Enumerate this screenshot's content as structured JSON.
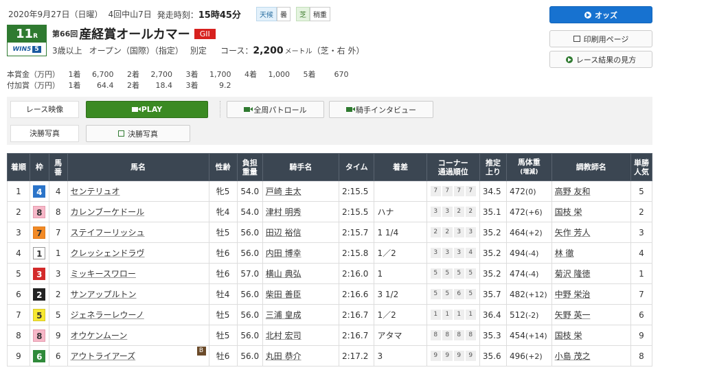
{
  "header": {
    "date": "2020年9月27日（日曜）",
    "meeting": "4回中山7日",
    "post_time_label": "発走時刻：",
    "post_time": "15時45分",
    "weather_label": "天候",
    "weather": "曇",
    "surface_label": "芝",
    "condition": "稍重"
  },
  "race": {
    "number": "11",
    "number_suffix": "R",
    "win5_label": "WIN5",
    "win5_num": "5",
    "edition": "第66回",
    "name": "産経賞オールカマー",
    "grade": "GII",
    "age": "3歳以上",
    "class": "オープン（国際）（指定）",
    "weight_rule": "別定",
    "course_label": "コース：",
    "distance": "2,200",
    "distance_unit": "メートル",
    "course_detail": "（芝・右 外）"
  },
  "prize": {
    "main_label": "本賞金（万円）",
    "main": [
      {
        "place": "1着",
        "amount": "6,700"
      },
      {
        "place": "2着",
        "amount": "2,700"
      },
      {
        "place": "3着",
        "amount": "1,700"
      },
      {
        "place": "4着",
        "amount": "1,000"
      },
      {
        "place": "5着",
        "amount": "670"
      }
    ],
    "extra_label": "付加賞（万円）",
    "extra": [
      {
        "place": "1着",
        "amount": "64.4"
      },
      {
        "place": "2着",
        "amount": "18.4"
      },
      {
        "place": "3着",
        "amount": "9.2"
      }
    ]
  },
  "side_buttons": {
    "odds": "オッズ",
    "print": "印刷用ページ",
    "guide": "レース結果の見方"
  },
  "media": {
    "video_label": "レース映像",
    "play": "PLAY",
    "patrol": "全周パトロール",
    "interview": "騎手インタビュー",
    "photo_label": "決勝写真",
    "photo_btn": "決勝写真"
  },
  "table": {
    "headers": [
      "着順",
      "枠",
      "馬番",
      "馬名",
      "性齢",
      "負担重量",
      "騎手名",
      "タイム",
      "着差",
      "コーナー通過順位",
      "推定上り",
      "馬体重(増減)",
      "調教師名",
      "単勝人気"
    ],
    "rows": [
      {
        "pos": "1",
        "waku": "4",
        "num": "4",
        "horse": "センテリュオ",
        "blinker": "",
        "sex_age": "牝5",
        "weight": "54.0",
        "jockey": "戸崎 圭太",
        "time": "2:15.5",
        "margin": "",
        "corner": [
          "7",
          "7",
          "7",
          "7"
        ],
        "last3f": "34.5",
        "body": "472",
        "diff": "(0)",
        "trainer": "高野 友和",
        "pop": "5"
      },
      {
        "pos": "2",
        "waku": "8",
        "num": "8",
        "horse": "カレンブーケドール",
        "blinker": "",
        "sex_age": "牝4",
        "weight": "54.0",
        "jockey": "津村 明秀",
        "time": "2:15.5",
        "margin": "ハナ",
        "corner": [
          "3",
          "3",
          "2",
          "2"
        ],
        "last3f": "35.1",
        "body": "472",
        "diff": "(+6)",
        "trainer": "国枝 栄",
        "pop": "2"
      },
      {
        "pos": "3",
        "waku": "7",
        "num": "7",
        "horse": "ステイフーリッシュ",
        "blinker": "",
        "sex_age": "牡5",
        "weight": "56.0",
        "jockey": "田辺 裕信",
        "time": "2:15.7",
        "margin": "1 1/4",
        "corner": [
          "2",
          "2",
          "3",
          "3"
        ],
        "last3f": "35.2",
        "body": "464",
        "diff": "(+2)",
        "trainer": "矢作 芳人",
        "pop": "3"
      },
      {
        "pos": "4",
        "waku": "1",
        "num": "1",
        "horse": "クレッシェンドラヴ",
        "blinker": "",
        "sex_age": "牡6",
        "weight": "56.0",
        "jockey": "内田 博幸",
        "time": "2:15.8",
        "margin": "1／2",
        "corner": [
          "3",
          "3",
          "3",
          "4"
        ],
        "last3f": "35.2",
        "body": "494",
        "diff": "(-4)",
        "trainer": "林 徹",
        "pop": "4"
      },
      {
        "pos": "5",
        "waku": "3",
        "num": "3",
        "horse": "ミッキースワロー",
        "blinker": "",
        "sex_age": "牡6",
        "weight": "57.0",
        "jockey": "横山 典弘",
        "time": "2:16.0",
        "margin": "1",
        "corner": [
          "5",
          "5",
          "5",
          "5"
        ],
        "last3f": "35.2",
        "body": "474",
        "diff": "(-4)",
        "trainer": "菊沢 隆徳",
        "pop": "1"
      },
      {
        "pos": "6",
        "waku": "2",
        "num": "2",
        "horse": "サンアップルトン",
        "blinker": "",
        "sex_age": "牡4",
        "weight": "56.0",
        "jockey": "柴田 善臣",
        "time": "2:16.6",
        "margin": "3 1/2",
        "corner": [
          "5",
          "5",
          "6",
          "5"
        ],
        "last3f": "35.7",
        "body": "482",
        "diff": "(+12)",
        "trainer": "中野 栄治",
        "pop": "7"
      },
      {
        "pos": "7",
        "waku": "5",
        "num": "5",
        "horse": "ジェネラーレウーノ",
        "blinker": "",
        "sex_age": "牡5",
        "weight": "56.0",
        "jockey": "三浦 皇成",
        "time": "2:16.7",
        "margin": "1／2",
        "corner": [
          "1",
          "1",
          "1",
          "1"
        ],
        "last3f": "36.4",
        "body": "512",
        "diff": "(-2)",
        "trainer": "矢野 英一",
        "pop": "6"
      },
      {
        "pos": "8",
        "waku": "8",
        "num": "9",
        "horse": "オウケンムーン",
        "blinker": "",
        "sex_age": "牡5",
        "weight": "56.0",
        "jockey": "北村 宏司",
        "time": "2:16.7",
        "margin": "アタマ",
        "corner": [
          "8",
          "8",
          "8",
          "8"
        ],
        "last3f": "35.3",
        "body": "454",
        "diff": "(+14)",
        "trainer": "国枝 栄",
        "pop": "9"
      },
      {
        "pos": "9",
        "waku": "6",
        "num": "6",
        "horse": "アウトライアーズ",
        "blinker": "B",
        "sex_age": "牡6",
        "weight": "56.0",
        "jockey": "丸田 恭介",
        "time": "2:17.2",
        "margin": "3",
        "corner": [
          "9",
          "9",
          "9",
          "9"
        ],
        "last3f": "35.6",
        "body": "496",
        "diff": "(+2)",
        "trainer": "小島 茂之",
        "pop": "8"
      }
    ]
  },
  "colors": {
    "waku": {
      "1": {
        "bg": "#ffffff",
        "fg": "#333333",
        "border": "#999999"
      },
      "2": {
        "bg": "#222222",
        "fg": "#ffffff",
        "border": "#222222"
      },
      "3": {
        "bg": "#d32a2a",
        "fg": "#ffffff",
        "border": "#d32a2a"
      },
      "4": {
        "bg": "#2b74c9",
        "fg": "#ffffff",
        "border": "#2b74c9"
      },
      "5": {
        "bg": "#f7e832",
        "fg": "#333333",
        "border": "#d8c82a"
      },
      "6": {
        "bg": "#2f8a3a",
        "fg": "#ffffff",
        "border": "#2f8a3a"
      },
      "7": {
        "bg": "#f28a26",
        "fg": "#333333",
        "border": "#e07b1a"
      },
      "8": {
        "bg": "#f6b8c8",
        "fg": "#333333",
        "border": "#e59aae"
      }
    },
    "header_bg": "#3b4652",
    "play_green": "#3b8a23",
    "odds_blue": "#1772d0",
    "grade_red": "#d7211e"
  }
}
